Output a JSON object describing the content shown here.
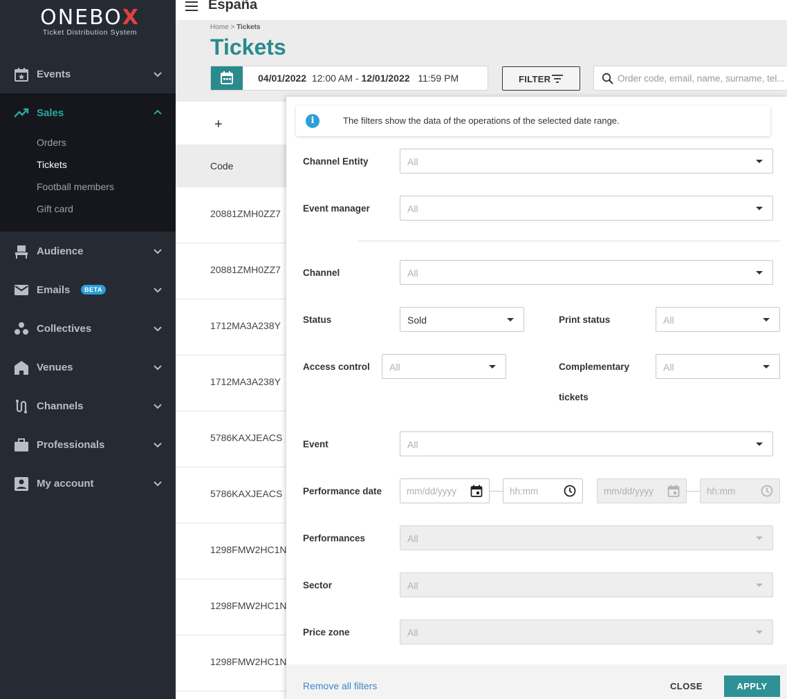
{
  "app": {
    "logo_text": "ONEBOX",
    "logo_subtitle": "Ticket Distribution System",
    "accent_color": "#2a8a8d",
    "sidebar_color": "#262a33"
  },
  "topbar": {
    "title": "España",
    "menu_icon": "hamburger-icon"
  },
  "sidebar": {
    "items": [
      {
        "label": "Events",
        "icon": "calendar-star-icon"
      },
      {
        "label": "Sales",
        "icon": "trending-up-icon"
      },
      {
        "label": "Audience",
        "icon": "seat-icon"
      },
      {
        "label": "Emails",
        "icon": "envelope-icon",
        "badge": "BETA"
      },
      {
        "label": "Collectives",
        "icon": "group-icon"
      },
      {
        "label": "Venues",
        "icon": "building-icon"
      },
      {
        "label": "Channels",
        "icon": "route-icon"
      },
      {
        "label": "Professionals",
        "icon": "briefcase-icon"
      },
      {
        "label": "My account",
        "icon": "account-box-icon"
      }
    ],
    "sales_sub": [
      {
        "label": "Orders"
      },
      {
        "label": "Tickets"
      },
      {
        "label": "Football members"
      },
      {
        "label": "Gift card"
      }
    ]
  },
  "header": {
    "breadcrumb_home": "Home",
    "breadcrumb_sep": " > ",
    "breadcrumb_current": "Tickets",
    "page_title": "Tickets",
    "date_from": "04/01/2022",
    "time_from": "12:00 AM",
    "date_sep": " - ",
    "date_to": "12/01/2022",
    "time_to": "11:59 PM",
    "filter_label": "FILTER",
    "search_placeholder": "Order code, email, name, surname, tel..."
  },
  "table": {
    "add_label": "+",
    "column_code": "Code",
    "rows": [
      "20881ZMH0ZZ7",
      "20881ZMH0ZZ7",
      "1712MA3A238Y",
      "1712MA3A238Y",
      "5786KAXJEACS",
      "5786KAXJEACS",
      "1298FMW2HC1N",
      "1298FMW2HC1N",
      "1298FMW2HC1N"
    ]
  },
  "filters": {
    "info": "The filters show the data of the operations of the selected date range.",
    "channel_entity": {
      "label": "Channel Entity",
      "value": "All"
    },
    "event_manager": {
      "label": "Event manager",
      "value": "All"
    },
    "channel": {
      "label": "Channel",
      "value": "All"
    },
    "status": {
      "label": "Status",
      "value": "Sold"
    },
    "print_status": {
      "label": "Print status",
      "value": "All"
    },
    "access_control": {
      "label": "Access control",
      "value": "All"
    },
    "complementary_line1": "Complementary",
    "complementary_line2": "tickets",
    "complementary_value": "All",
    "event": {
      "label": "Event",
      "value": "All"
    },
    "performance_date": {
      "label": "Performance date",
      "date_placeholder": "mm/dd/yyyy",
      "time_placeholder": "hh:mm"
    },
    "performances": {
      "label": "Performances",
      "value": "All"
    },
    "sector": {
      "label": "Sector",
      "value": "All"
    },
    "price_zone": {
      "label": "Price zone",
      "value": "All"
    },
    "remove_all": "Remove all filters",
    "close": "CLOSE",
    "apply": "APPLY"
  }
}
